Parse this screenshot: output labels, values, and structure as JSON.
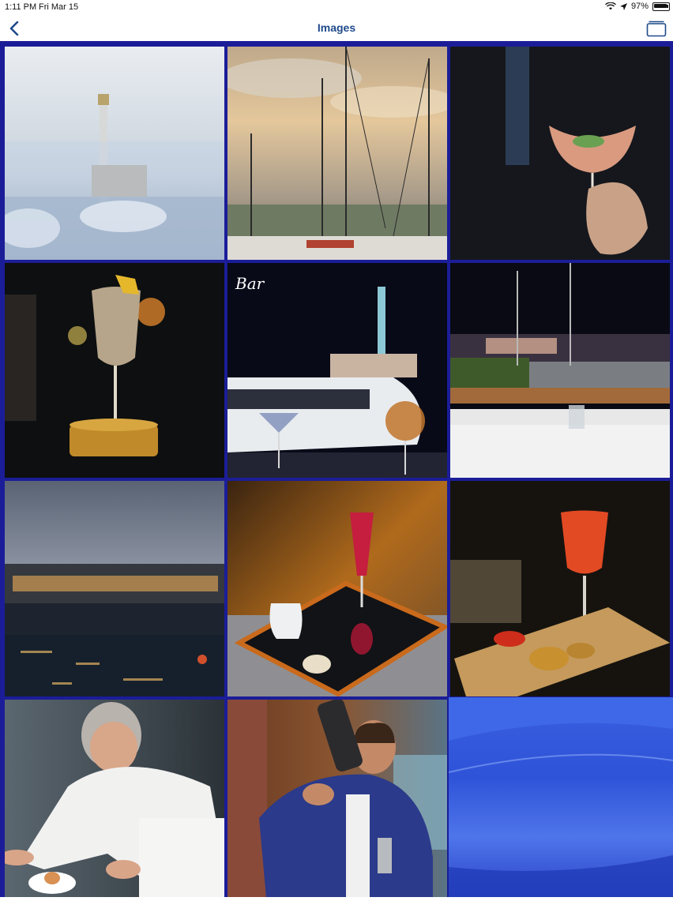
{
  "status_bar": {
    "time": "1:11 PM",
    "date": "Fri Mar 15",
    "battery_percent": "97%",
    "icons": [
      "wifi-icon",
      "location-icon",
      "battery-icon"
    ]
  },
  "nav": {
    "title": "Images",
    "back_icon": "chevron-left-icon",
    "right_icon": "gallery-stack-icon",
    "tint_color": "#1f4a8a"
  },
  "gallery": {
    "background_color": "#1b1d98",
    "images": [
      {
        "subject": "harbor-lighthouse-photo"
      },
      {
        "subject": "sailboat-masts-photo"
      },
      {
        "subject": "cocktail-glass-hand-photo"
      },
      {
        "subject": "cocktail-on-wooden-stand-photo"
      },
      {
        "subject": "bar-yacht-cocktails-photo",
        "overlay_text": "Bar"
      },
      {
        "subject": "restaurant-table-harbor-night-photo"
      },
      {
        "subject": "waterfront-evening-photo"
      },
      {
        "subject": "cocktail-mirror-tray-photo"
      },
      {
        "subject": "red-cocktail-bruschetta-photo"
      },
      {
        "subject": "chef-plating-photo"
      },
      {
        "subject": "bartender-shaker-photo"
      }
    ]
  }
}
